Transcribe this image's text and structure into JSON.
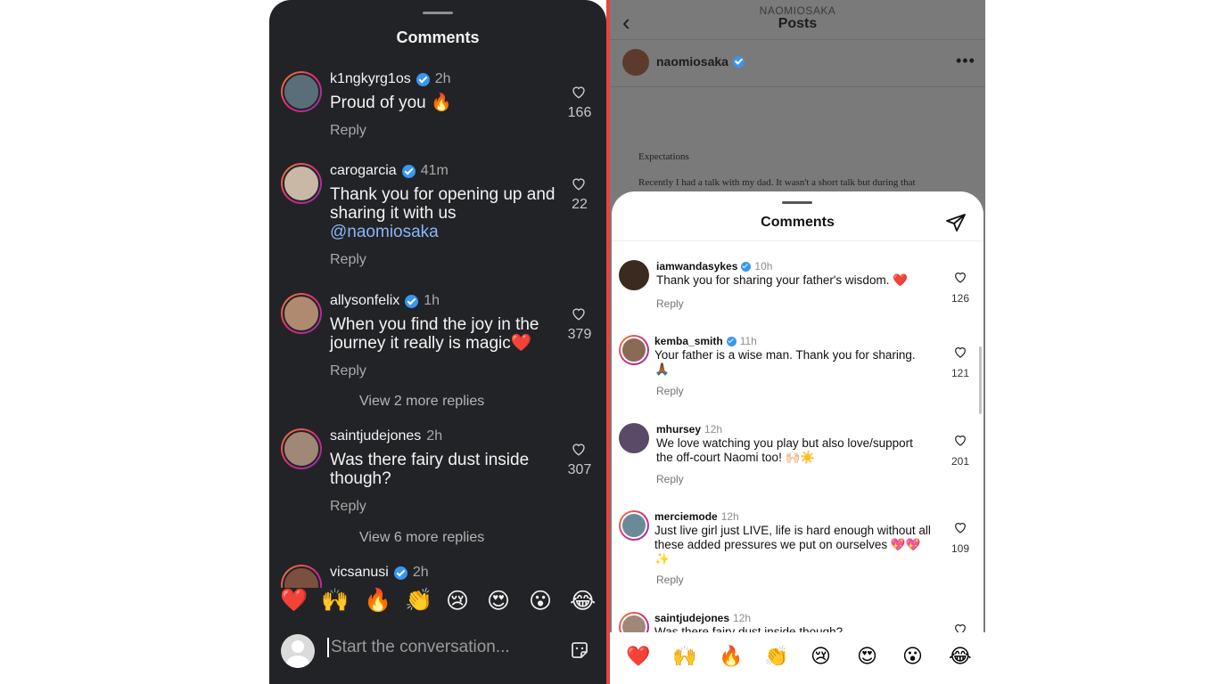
{
  "left": {
    "title": "Comments",
    "comments": [
      {
        "user": "k1ngkyrg1os",
        "time": "2h",
        "text": "Proud of you 🔥",
        "reply": "Reply",
        "likes": "166"
      },
      {
        "user": "carogarcia",
        "time": "41m",
        "text": "Thank you for opening up and sharing it with us",
        "mention": "@naomiosaka",
        "reply": "Reply",
        "likes": "22"
      },
      {
        "user": "allysonfelix",
        "time": "1h",
        "text": "When you find the joy in the journey it really is magic❤️",
        "reply": "Reply",
        "likes": "379",
        "more": "View 2 more replies"
      },
      {
        "user": "saintjudejones",
        "time": "2h",
        "text": "Was there fairy dust inside though?",
        "reply": "Reply",
        "likes": "307",
        "more": "View 6 more replies"
      },
      {
        "user": "vicsanusi",
        "time": "2h"
      }
    ],
    "emojis": [
      "❤️",
      "🙌",
      "🔥",
      "👏",
      "😢",
      "😍",
      "😮",
      "😂"
    ],
    "input_placeholder": "Start the conversation..."
  },
  "right": {
    "header": {
      "username": "NAOMIOSAKA",
      "title": "Posts",
      "back": "‹",
      "menu": "•••"
    },
    "post": {
      "author": "naomiosaka",
      "line1": "Expectations",
      "line2": "Recently I had a talk with my dad. It wasn't a short talk but during that"
    },
    "sheet_title": "Comments",
    "comments": [
      {
        "user": "iamwandasykes",
        "time": "10h",
        "text": "Thank you for sharing your father's wisdom. ❤️",
        "reply": "Reply",
        "likes": "126"
      },
      {
        "user": "kemba_smith",
        "time": "11h",
        "text": "Your father is a wise man. Thank you for sharing. 🙏🏾",
        "reply": "Reply",
        "likes": "121"
      },
      {
        "user": "mhursey",
        "time": "12h",
        "text": "We love watching you play but also love/support the off-court Naomi too! 🙌🏻☀️",
        "reply": "Reply",
        "likes": "201"
      },
      {
        "user": "merciemode",
        "time": "12h",
        "text": "Just live girl just LIVE, life is hard enough without all these added pressures we put on ourselves 💖💖✨",
        "reply": "Reply",
        "likes": "109"
      },
      {
        "user": "saintjudejones",
        "time": "12h",
        "text": "Was there fairy dust inside though?"
      }
    ],
    "emojis": [
      "❤️",
      "🙌",
      "🔥",
      "👏",
      "😢",
      "😍",
      "😮",
      "😂"
    ]
  },
  "colors": {
    "dark_bg": "#222326",
    "divider": "#e6443f",
    "verified": "#3897f0",
    "mention": "#8ab4f8"
  }
}
